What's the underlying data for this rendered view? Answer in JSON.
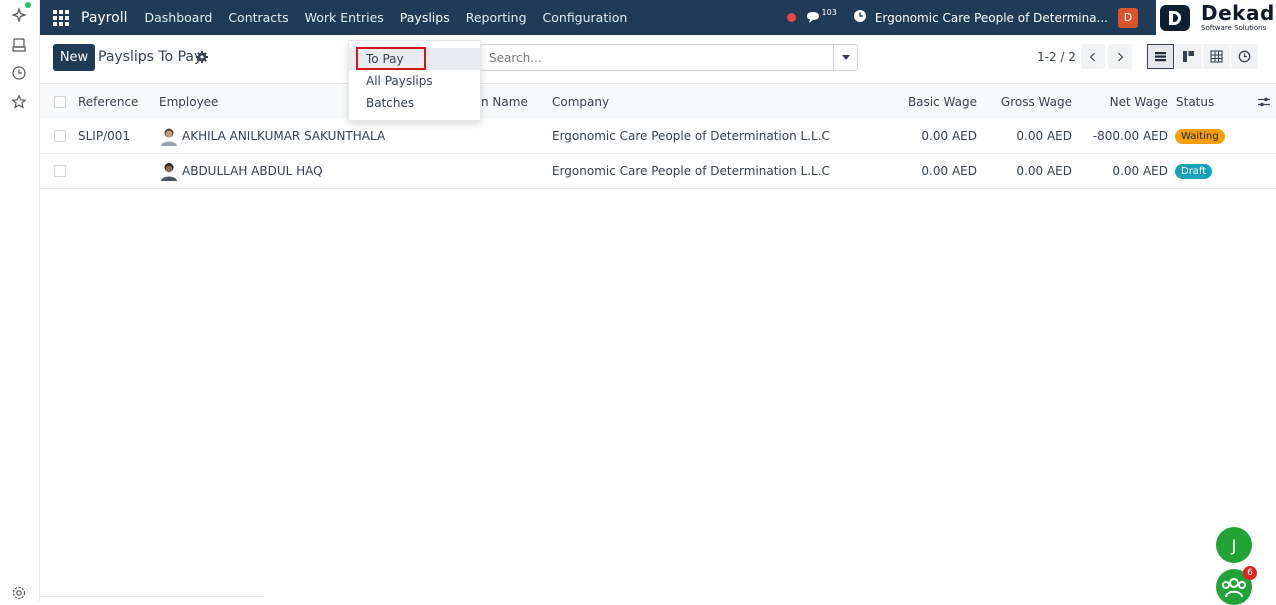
{
  "app": {
    "name": "Payroll",
    "nav": [
      "Dashboard",
      "Contracts",
      "Work Entries",
      "Payslips",
      "Reporting",
      "Configuration"
    ],
    "active_nav": "Payslips",
    "message_count": "103",
    "company": "Ergonomic Care People of Determina...",
    "user_initial": "D",
    "logo_name": "Dekad",
    "logo_sub": "Software Solutions"
  },
  "control_panel": {
    "new_label": "New",
    "breadcrumb": "Payslips To Pay",
    "search_placeholder": "Search...",
    "pager": "1-2 / 2"
  },
  "payslips_menu": {
    "items": [
      "To Pay",
      "All Payslips",
      "Batches"
    ],
    "active": "To Pay"
  },
  "table": {
    "columns": {
      "reference": "Reference",
      "employee": "Employee",
      "name": "n Name",
      "company": "Company",
      "basic_wage": "Basic Wage",
      "gross_wage": "Gross Wage",
      "net_wage": "Net Wage",
      "status": "Status"
    },
    "rows": [
      {
        "reference": "SLIP/001",
        "employee": "AKHILA ANILKUMAR SAKUNTHALA",
        "company": "Ergonomic Care People of Determination L.L.C",
        "basic_wage": "0.00 AED",
        "gross_wage": "0.00 AED",
        "net_wage": "-800.00 AED",
        "status": "Waiting"
      },
      {
        "reference": "",
        "employee": "ABDULLAH ABDUL HAQ",
        "company": "Ergonomic Care People of Determination L.L.C",
        "basic_wage": "0.00 AED",
        "gross_wage": "0.00 AED",
        "net_wage": "0.00 AED",
        "status": "Draft"
      }
    ]
  },
  "floating": {
    "chat_initial": "J",
    "group_count": "6"
  },
  "colors": {
    "navbar": "#1f3b57",
    "status_waiting": "#f59e0b",
    "status_draft": "#17a2b8",
    "highlight": "#d4151c",
    "floating": "#21a336"
  }
}
